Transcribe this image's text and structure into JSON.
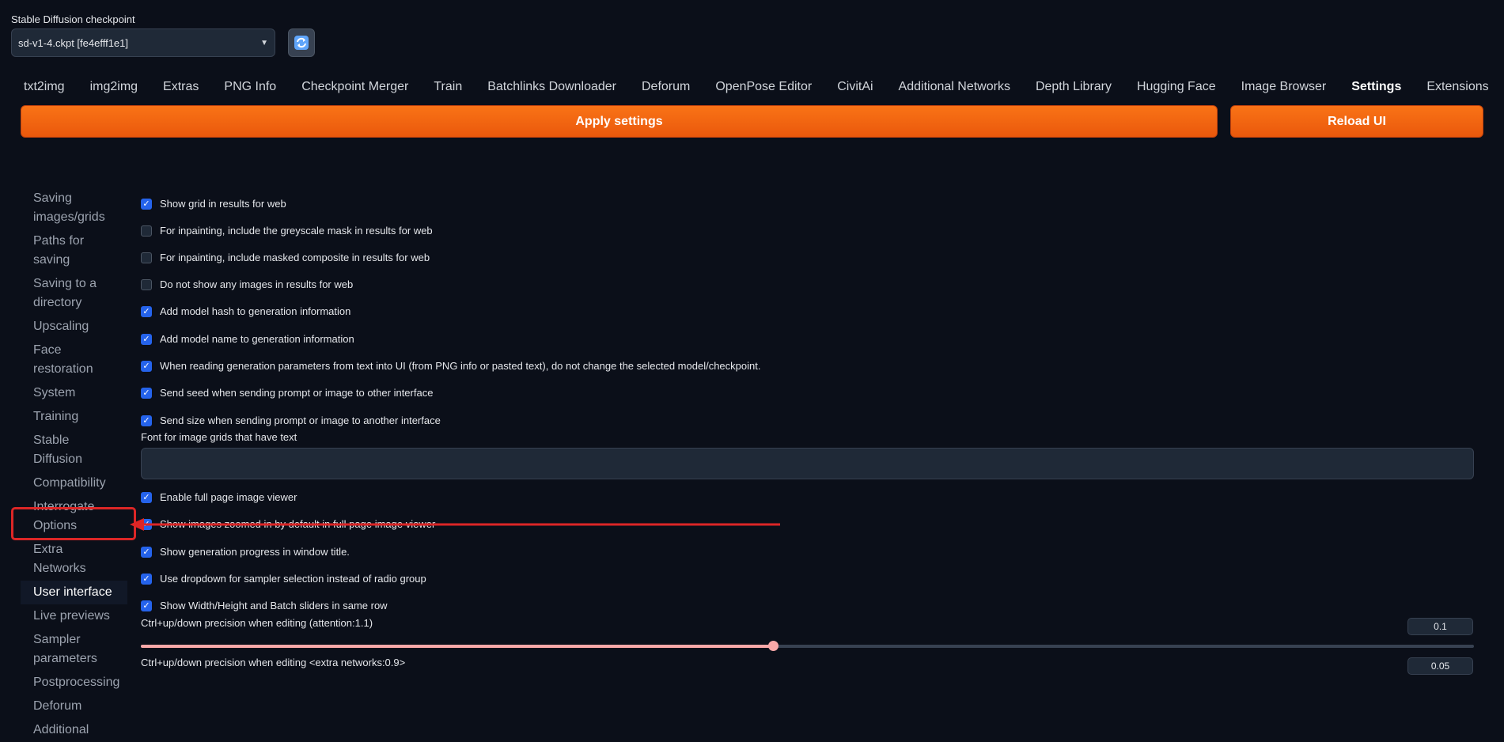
{
  "checkpoint": {
    "label": "Stable Diffusion checkpoint",
    "value": "sd-v1-4.ckpt [fe4efff1e1]"
  },
  "tabs": [
    {
      "label": "txt2img",
      "active": false
    },
    {
      "label": "img2img",
      "active": false
    },
    {
      "label": "Extras",
      "active": false
    },
    {
      "label": "PNG Info",
      "active": false
    },
    {
      "label": "Checkpoint Merger",
      "active": false
    },
    {
      "label": "Train",
      "active": false
    },
    {
      "label": "Batchlinks Downloader",
      "active": false
    },
    {
      "label": "Deforum",
      "active": false
    },
    {
      "label": "OpenPose Editor",
      "active": false
    },
    {
      "label": "CivitAi",
      "active": false
    },
    {
      "label": "Additional Networks",
      "active": false
    },
    {
      "label": "Depth Library",
      "active": false
    },
    {
      "label": "Hugging Face",
      "active": false
    },
    {
      "label": "Image Browser",
      "active": false
    },
    {
      "label": "Settings",
      "active": true
    },
    {
      "label": "Extensions",
      "active": false
    }
  ],
  "buttons": {
    "apply": "Apply settings",
    "reload": "Reload UI"
  },
  "sidebar": [
    "Saving images/grids",
    "Paths for saving",
    "Saving to a directory",
    "Upscaling",
    "Face restoration",
    "System",
    "Training",
    "Stable Diffusion",
    "Compatibility",
    "Interrogate Options",
    "Extra Networks",
    "User interface",
    "Live previews",
    "Sampler parameters",
    "Postprocessing",
    "Deforum",
    "Additional"
  ],
  "sidebar_active": "User interface",
  "checkboxes_a": [
    {
      "label": "Show grid in results for web",
      "checked": true
    },
    {
      "label": "For inpainting, include the greyscale mask in results for web",
      "checked": false
    },
    {
      "label": "For inpainting, include masked composite in results for web",
      "checked": false
    },
    {
      "label": "Do not show any images in results for web",
      "checked": false
    },
    {
      "label": "Add model hash to generation information",
      "checked": true
    },
    {
      "label": "Add model name to generation information",
      "checked": true
    },
    {
      "label": "When reading generation parameters from text into UI (from PNG info or pasted text), do not change the selected model/checkpoint.",
      "checked": true
    },
    {
      "label": "Send seed when sending prompt or image to other interface",
      "checked": true
    },
    {
      "label": "Send size when sending prompt or image to another interface",
      "checked": true
    }
  ],
  "font_field": {
    "label": "Font for image grids that have text",
    "value": ""
  },
  "checkboxes_b": [
    {
      "label": "Enable full page image viewer",
      "checked": true
    },
    {
      "label": "Show images zoomed in by default in full page image viewer",
      "checked": true
    },
    {
      "label": "Show generation progress in window title.",
      "checked": true
    },
    {
      "label": "Use dropdown for sampler selection instead of radio group",
      "checked": true
    },
    {
      "label": "Show Width/Height and Batch sliders in same row",
      "checked": true
    }
  ],
  "slider_attention": {
    "label": "Ctrl+up/down precision when editing (attention:1.1)",
    "value": "0.1",
    "fraction": 0.474
  },
  "slider_extra": {
    "label": "Ctrl+up/down precision when editing <extra networks:0.9>",
    "value": "0.05"
  },
  "colors": {
    "accent_orange": "#f97316",
    "highlight_red": "#dc2626",
    "checkbox_blue": "#2563eb",
    "slider_pink": "#f9a8a8"
  }
}
